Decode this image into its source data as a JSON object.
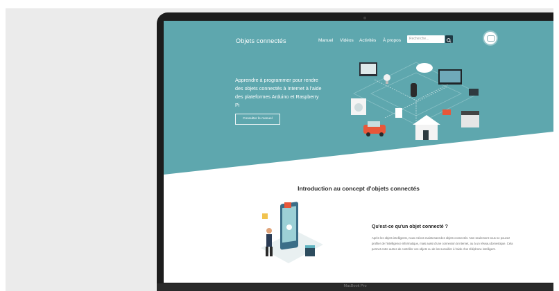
{
  "device": {
    "model_label": "MacBook Pro"
  },
  "nav": {
    "logo": "Objets connectés",
    "links": [
      "Manuel",
      "Vidéos",
      "Activités",
      "À propos"
    ],
    "search_placeholder": "Recherche..."
  },
  "hero": {
    "title": "Apprendre à programmer pour rendre des objets connectés à Internet à l'aide des plateformes Arduino et Raspberry Pi",
    "button": "Consulter le manuel"
  },
  "intro": {
    "heading": "Introduction au concept d'objets connectés"
  },
  "section": {
    "title": "Qu'est-ce qu'un objet connecté ?",
    "body": "Après les objets intelligents, nous créons maintenant des objets connectés. Non seulement vous ne pouvez profiter de l'intelligence informatique, mais aussi d'une connexion à Internet, ou à un réseau domestique. Cela permet entre autres de contrôler ces objets ou de les surveiller à l'aide d'un téléphone intelligent."
  },
  "colors": {
    "hero": "#5ea7ae",
    "button_dark": "#1f3a44",
    "accent_orange": "#e8573a",
    "backdrop": "#ebebeb",
    "bezel": "#1c1c1c"
  }
}
